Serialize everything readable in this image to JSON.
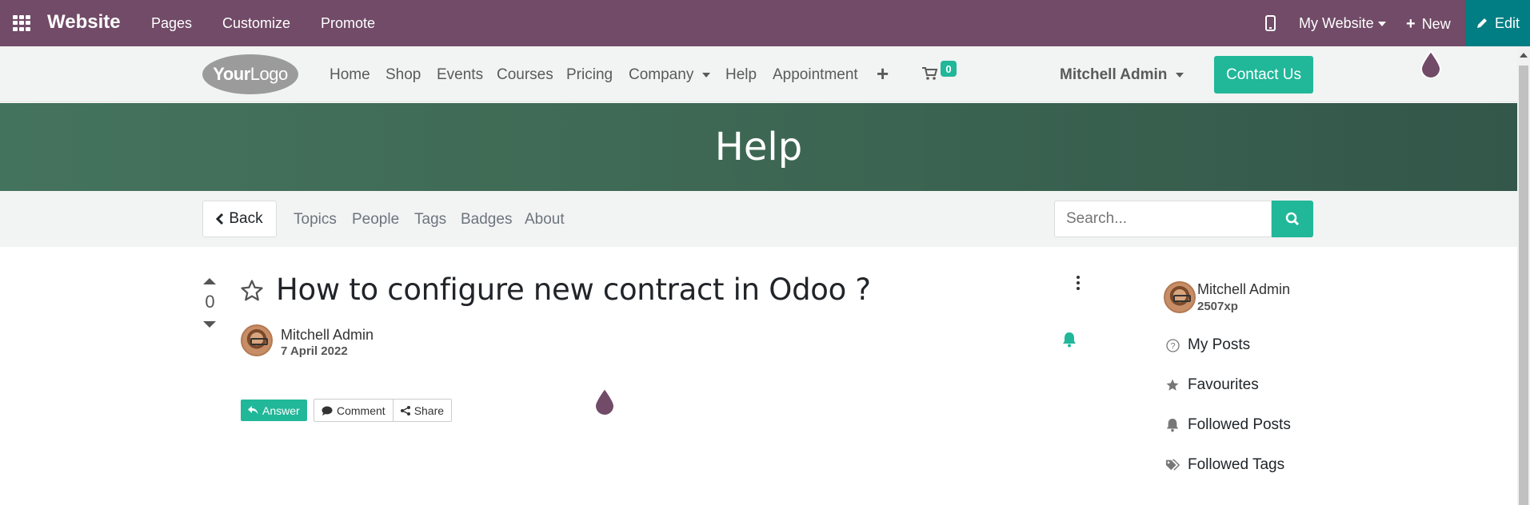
{
  "admin_bar": {
    "brand": "Website",
    "menus": [
      "Pages",
      "Customize",
      "Promote"
    ],
    "website_selector": "My Website",
    "new_label": "New",
    "edit_label": "Edit",
    "bg_color": "#714b67",
    "edit_color": "#017e84"
  },
  "header": {
    "logo_text_bold": "Your",
    "logo_text_light": "Logo",
    "nav": [
      "Home",
      "Shop",
      "Events",
      "Courses",
      "Pricing",
      "Company",
      "Help",
      "Appointment"
    ],
    "cart_count": "0",
    "user": "Mitchell Admin",
    "contact_button": "Contact Us",
    "accent_color": "#21b799"
  },
  "hero": {
    "title": "Help"
  },
  "forum_nav": {
    "back_label": "Back",
    "items": [
      "Topics",
      "People",
      "Tags",
      "Badges",
      "About"
    ],
    "search_placeholder": "Search..."
  },
  "question": {
    "votes": "0",
    "title": "How to configure new contract in Odoo ?",
    "author": "Mitchell Admin",
    "date": "7 April 2022",
    "answer_label": "Answer",
    "comment_label": "Comment",
    "share_label": "Share"
  },
  "sidebar": {
    "user": "Mitchell Admin",
    "xp": "2507xp",
    "items": [
      "My Posts",
      "Favourites",
      "Followed Posts",
      "Followed Tags"
    ]
  }
}
